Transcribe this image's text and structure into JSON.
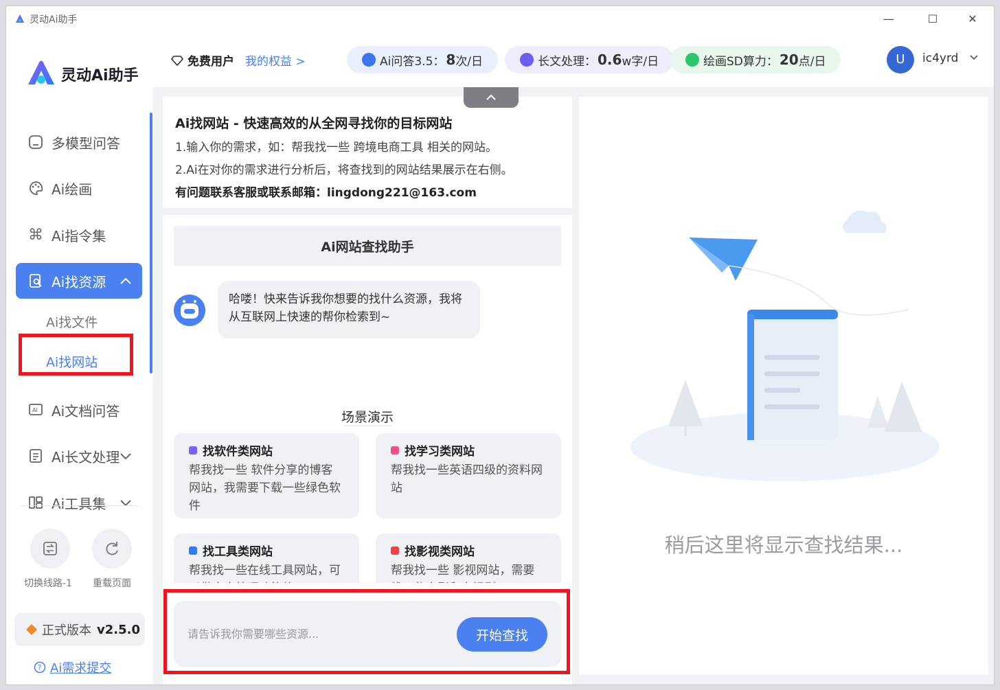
{
  "window": {
    "title": "灵动Ai助手",
    "minimize": "—",
    "maximize": "☐",
    "close": "✕"
  },
  "brand": {
    "name": "灵动Ai助手",
    "accent": "#4a80f0",
    "highlight": "#f0141e"
  },
  "sidebar": {
    "items": [
      {
        "label": "多模型问答",
        "icon": "chat-bubble-icon"
      },
      {
        "label": "Ai绘画",
        "icon": "palette-icon"
      },
      {
        "label": "Ai指令集",
        "icon": "command-icon"
      },
      {
        "label": "Ai找资源",
        "icon": "search-doc-icon"
      },
      {
        "label": "Ai文档问答",
        "icon": "ai-doc-icon"
      },
      {
        "label": "Ai长文处理",
        "icon": "long-text-icon"
      },
      {
        "label": "Ai工具集",
        "icon": "tools-icon"
      }
    ],
    "sub_items": [
      "Ai找文件",
      "Ai找网站"
    ],
    "switch_line": "切换线路-1",
    "reload": "重载页面",
    "version_label": "正式版本",
    "version": "v2.5.0",
    "feedback": "Ai需求提交"
  },
  "topbar": {
    "user_type": "免费用户",
    "benefits": "我的权益 >",
    "quotas": [
      {
        "label": "Ai问答3.5：",
        "value": "8",
        "unit": "次/日"
      },
      {
        "label": "长文处理：",
        "value": "0.6",
        "unit": "w字/日"
      },
      {
        "label": "绘画SD算力：",
        "value": "20",
        "unit": "点/日"
      }
    ],
    "avatar_letter": "U",
    "username": "ic4yrd"
  },
  "info": {
    "title": "Ai找网站 - 快速高效的从全网寻找你的目标网站",
    "line1": "1.输入你的需求，如：帮我找一些 跨境电商工具 相关的网站。",
    "line2": "2.Ai在对你的需求进行分析后，将查找到的网站结果展示在右侧。",
    "contact": "有问题联系客服或联系邮箱：lingdong221@163.com"
  },
  "chat": {
    "header": "Ai网站查找助手",
    "greeting": "哈喽！快来告诉我你想要的找什么资源，我将从互联网上快速的帮你检索到~",
    "scene_title": "场景演示",
    "scenes": [
      {
        "title": "找软件类网站",
        "desc": "帮我找一些 软件分享的博客网站，我需要下载一些绿色软件",
        "color": "#7b61ff"
      },
      {
        "title": "找学习类网站",
        "desc": "帮我找一些英语四级的资料网站",
        "color": "#f0508a"
      },
      {
        "title": "找工具类网站",
        "desc": "帮我找一些在线工具网站，可以做文本处理功能的",
        "color": "#2f7cf6"
      },
      {
        "title": "找影视类网站",
        "desc": "帮我找一些 影视网站，需要找一些电影和电视剧",
        "color": "#f0424a"
      }
    ],
    "input_placeholder": "请告诉我你需要哪些资源...",
    "search_button": "开始查找"
  },
  "results": {
    "empty_text": "稍后这里将显示查找结果..."
  }
}
